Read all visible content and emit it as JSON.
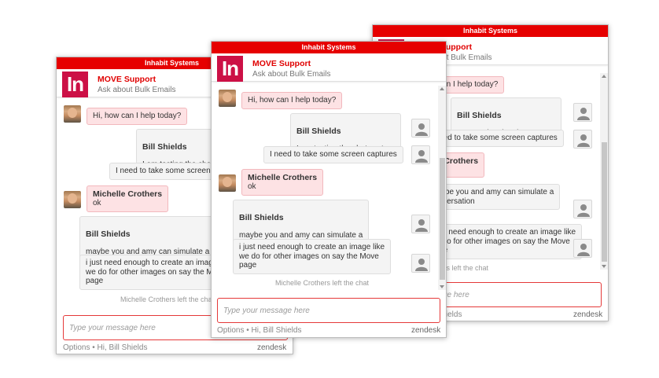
{
  "widget": {
    "topbar_title": "Inhabit Systems",
    "logo_text": "In",
    "title": "MOVE Support",
    "subtitle": "Ask about Bulk Emails",
    "input_placeholder": "Type your message here",
    "footer_options": "Options",
    "footer_separator": "•",
    "footer_greeting": "Hi, Bill Shields",
    "brand": "zendesk",
    "accent_color": "#e60000",
    "logo_color": "#cc1046"
  },
  "messages": {
    "agent_greeting": "Hi, how can I help today?",
    "user_name": "Bill Shields",
    "user_msg_1": "I am testing the chat system",
    "user_msg_2": "I need to take some screen captures",
    "agent_name": "Michelle Crothers",
    "agent_reply": "ok",
    "user_msg_3": "maybe you and amy can simulate a\nconversation",
    "user_msg_4": "i just need enough to create an image like\nwe do for other images on say the Move\npage",
    "system_left": "Michelle Crothers left the chat"
  }
}
